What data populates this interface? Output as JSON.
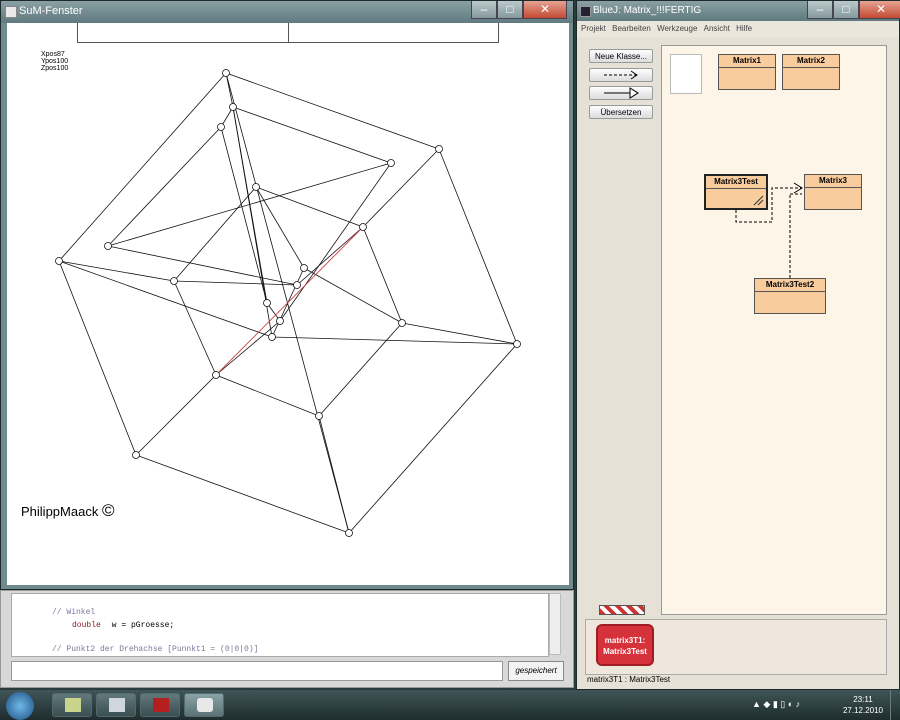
{
  "sum_window": {
    "title": "SuM-Fenster",
    "pos": {
      "x": "Xpos87",
      "y": "Ypos100",
      "z": "Zpos100"
    },
    "signature": "PhilippMaack",
    "copyright": "©"
  },
  "editor": {
    "lines": [
      {
        "cls": "cmt",
        "text": "// Winkel"
      },
      {
        "cls": "kw",
        "text": "double"
      },
      {
        "cls": "",
        "text": " w = pGroesse;"
      },
      {
        "cls": "cmt",
        "text": "// Punkt2 der Drehachse [Punnkt1 = (0|0|0)]"
      }
    ],
    "saved_label": "gespeichert"
  },
  "bluej": {
    "title": "BlueJ:  Matrix_!!!FERTIG",
    "menu": [
      "Projekt",
      "Bearbeiten",
      "Werkzeuge",
      "Ansicht",
      "Hilfe"
    ],
    "buttons": {
      "new_class": "Neue Klasse...",
      "compile": "Übersetzen"
    },
    "classes": [
      "Matrix1",
      "Matrix2",
      "Matrix3Test",
      "Matrix3",
      "Matrix3Test2"
    ],
    "object": {
      "line1": "matrix3T1:",
      "line2": "Matrix3Test"
    },
    "status": "matrix3T1 : Matrix3Test"
  },
  "taskbar": {
    "time": "23:11",
    "date": "27.12.2010"
  },
  "colors": {
    "class_fill": "#f9cc9e",
    "object_fill": "#d6323b",
    "diagram_bg": "#fdf6e8"
  }
}
